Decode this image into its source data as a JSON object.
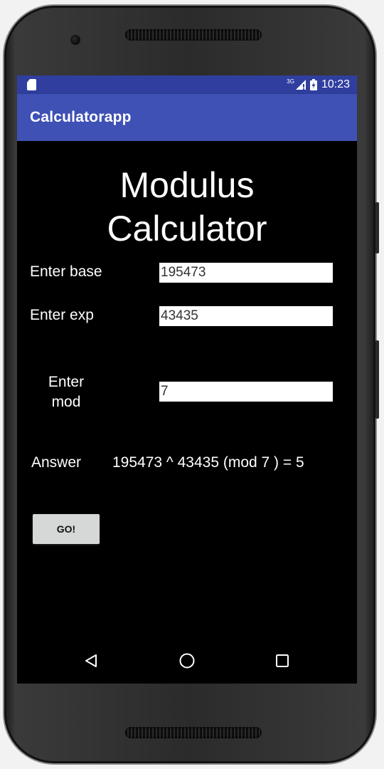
{
  "status_bar": {
    "network": "3G",
    "time": "10:23"
  },
  "app_bar": {
    "title": "Calculatorapp"
  },
  "main": {
    "title_line1": "Modulus",
    "title_line2": "Calculator",
    "base_label": "Enter base",
    "base_value": "195473",
    "exp_label": "Enter exp",
    "exp_value": "43435",
    "mod_label_line1": "Enter",
    "mod_label_line2": "mod",
    "mod_value": "7",
    "answer_label": "Answer",
    "answer_value": "195473 ^ 43435 (mod 7 ) = 5",
    "go_button": "GO!"
  },
  "nav_bar": {
    "icons": [
      "back-icon",
      "home-icon",
      "recents-icon"
    ]
  },
  "colors": {
    "status_bar": "#303f9f",
    "app_bar": "#3f51b5",
    "background": "#000000",
    "button": "#d6d7d7"
  }
}
